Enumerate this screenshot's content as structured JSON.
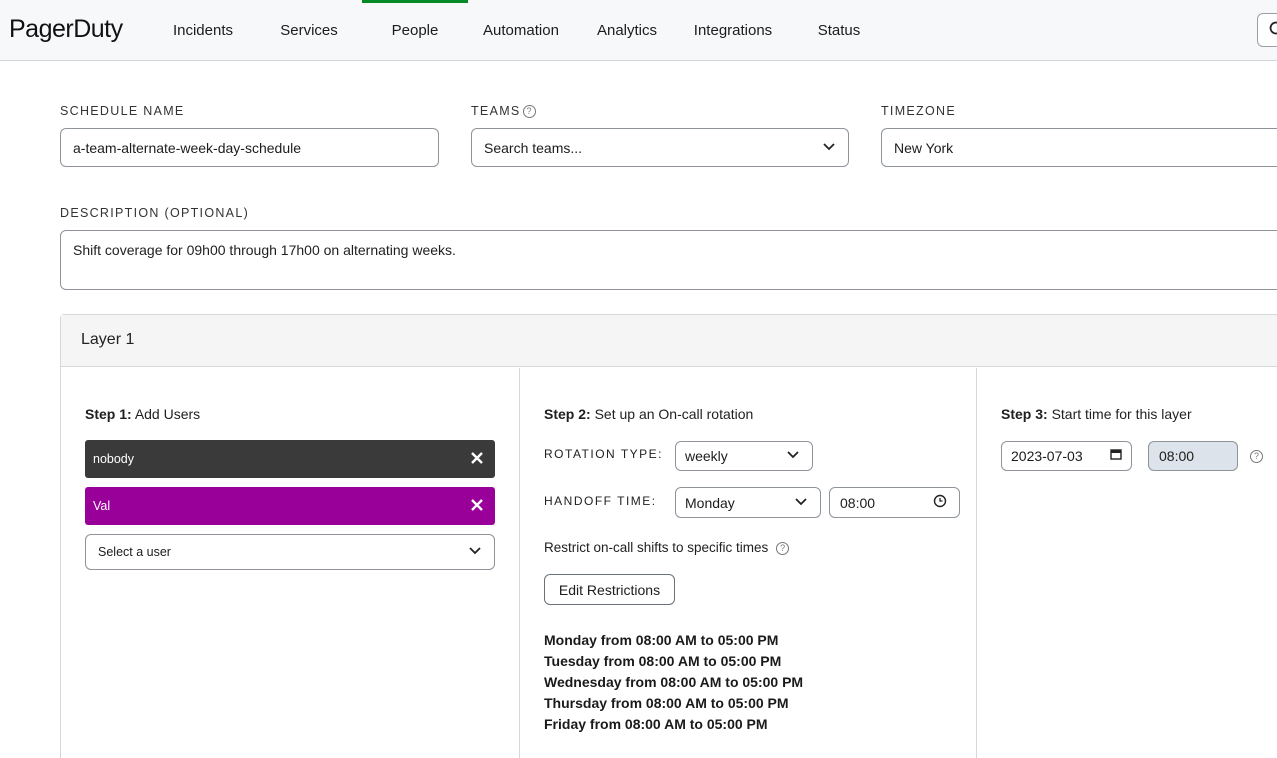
{
  "nav": {
    "logo": "PagerDuty",
    "items": [
      {
        "label": "Incidents"
      },
      {
        "label": "Services"
      },
      {
        "label": "People",
        "active": true
      },
      {
        "label": "Automation"
      },
      {
        "label": "Analytics"
      },
      {
        "label": "Integrations"
      },
      {
        "label": "Status"
      }
    ],
    "search_icon": "search-icon",
    "active_color": "#048a24"
  },
  "form": {
    "schedule_name_label": "SCHEDULE NAME",
    "schedule_name_value": "a-team-alternate-week-day-schedule",
    "teams_label": "TEAMS",
    "teams_placeholder": "Search teams...",
    "timezone_label": "TIMEZONE",
    "timezone_value": "New York",
    "description_label": "DESCRIPTION (OPTIONAL)",
    "description_value": "Shift coverage for 09h00 through 17h00 on alternating weeks."
  },
  "layer": {
    "title": "Layer 1",
    "step1": {
      "prefix": "Step 1:",
      "text": "Add Users",
      "users": [
        {
          "name": "nobody",
          "color": "#3a3a3a"
        },
        {
          "name": "Val",
          "color": "#990099"
        }
      ],
      "select_placeholder": "Select a user"
    },
    "step2": {
      "prefix": "Step 2:",
      "text": "Set up an On-call rotation",
      "rotation_type_label": "ROTATION TYPE:",
      "rotation_type_value": "weekly",
      "handoff_label": "HANDOFF TIME:",
      "handoff_day": "Monday",
      "handoff_time": "08:00",
      "restrict_label": "Restrict on-call shifts to specific times",
      "edit_button": "Edit Restrictions",
      "restrictions": [
        "Monday from 08:00 AM to 05:00 PM",
        "Tuesday from 08:00 AM to 05:00 PM",
        "Wednesday from 08:00 AM to 05:00 PM",
        "Thursday from 08:00 AM to 05:00 PM",
        "Friday from 08:00 AM to 05:00 PM"
      ]
    },
    "step3": {
      "prefix": "Step 3:",
      "text": "Start time for this layer",
      "start_date": "2023-07-03",
      "start_time": "08:00"
    }
  }
}
